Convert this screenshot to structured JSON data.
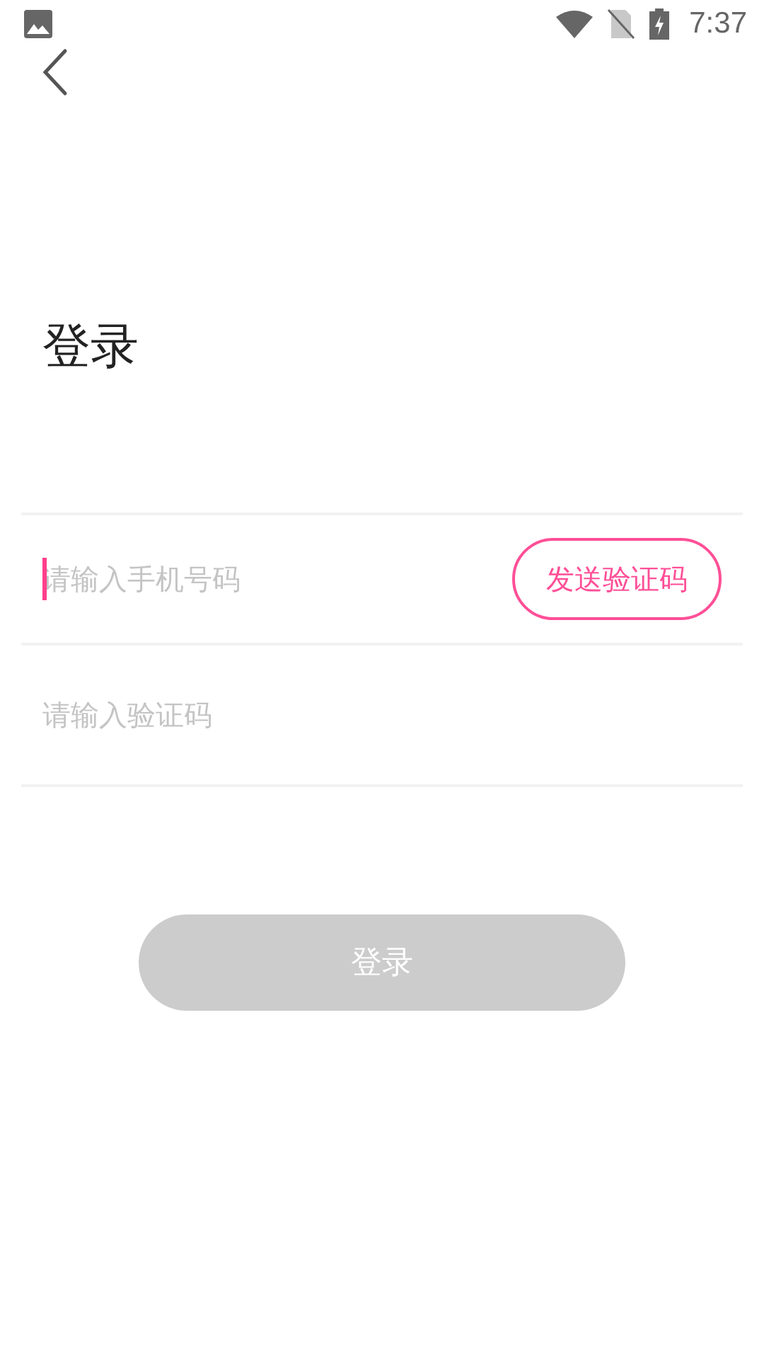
{
  "status_bar": {
    "time": "7:37"
  },
  "title": "登录",
  "fields": [
    {
      "placeholder": "请输入手机号码",
      "focused": true,
      "action": "发送验证码"
    },
    {
      "placeholder": "请输入验证码",
      "focused": false
    }
  ],
  "login_button": {
    "label": "登录",
    "disabled": true
  }
}
